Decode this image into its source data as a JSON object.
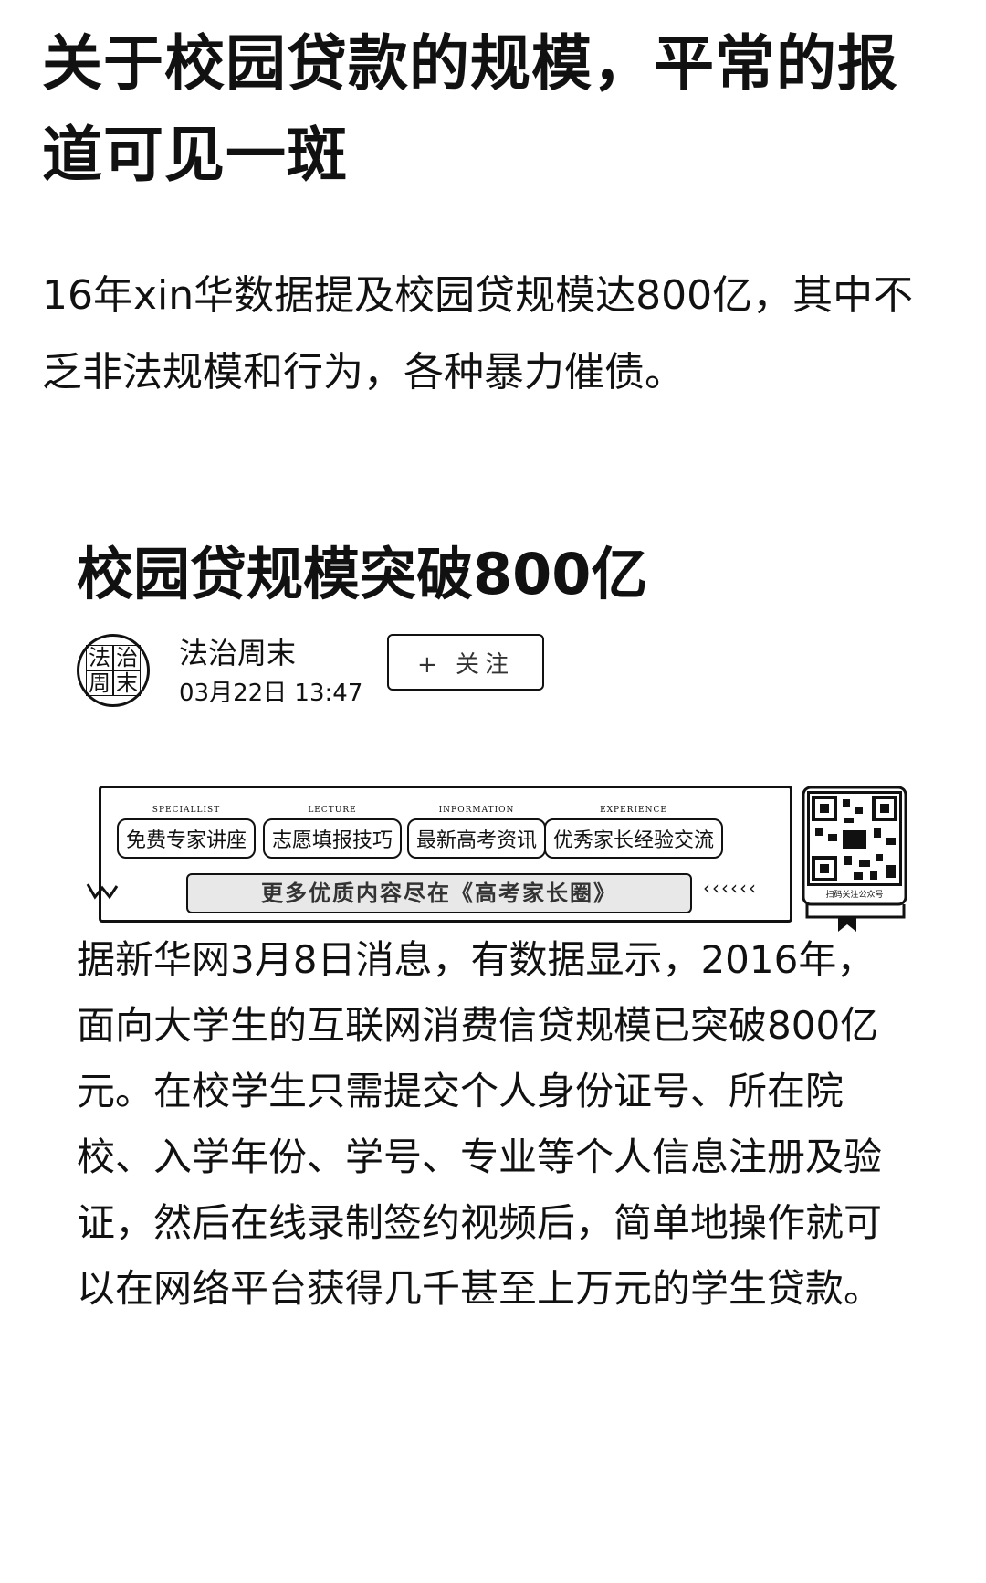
{
  "headline": "关于校园贷款的规模，平常的报道可见一斑",
  "intro": "16年xin华数据提及校园贷规模达800亿，其中不乏非法规模和行为，各种暴力催债。",
  "card": {
    "title": "校园贷规模突破800亿",
    "author": {
      "avatar_text": [
        "法",
        "治",
        "周",
        "末"
      ],
      "name": "法治周末",
      "time": "03月22日 13:47"
    },
    "follow_label": "+ 关注",
    "banner": {
      "topics": [
        {
          "en": "SPECIALLIST",
          "cn": "免费专家讲座"
        },
        {
          "en": "LECTURE",
          "cn": "志愿填报技巧"
        },
        {
          "en": "INFORMATION",
          "cn": "最新高考资讯"
        },
        {
          "en": "EXPERIENCE",
          "cn": "优秀家长经验交流"
        }
      ],
      "link_label": "更多优质内容尽在《高考家长圈》",
      "arrows": "‹‹‹‹‹‹",
      "qr_caption": "扫码关注公众号"
    }
  },
  "body": "据新华网3月8日消息，有数据显示，2016年，面向大学生的互联网消费信贷规模已突破800亿元。在校学生只需提交个人身份证号、所在院校、入学年份、学号、专业等个人信息注册及验证，然后在线录制签约视频后，简单地操作就可以在网络平台获得几千甚至上万元的学生贷款。"
}
